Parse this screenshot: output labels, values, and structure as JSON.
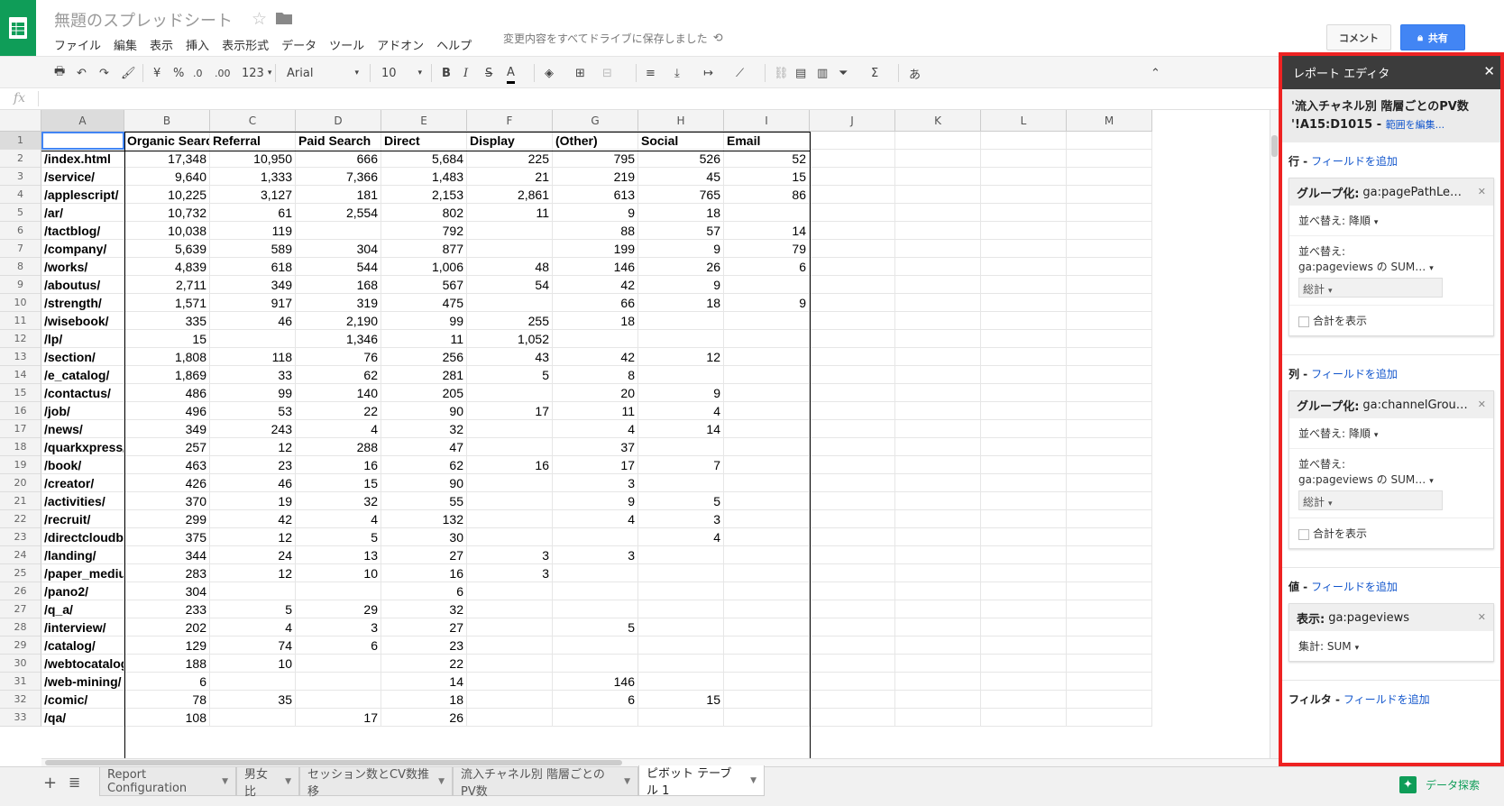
{
  "doc": {
    "title": "無題のスプレッドシート",
    "saved_status": "変更内容をすべてドライブに保存しました",
    "comment_label": "コメント",
    "share_label": "共有"
  },
  "menu": [
    "ファイル",
    "編集",
    "表示",
    "挿入",
    "表示形式",
    "データ",
    "ツール",
    "アドオン",
    "ヘルプ"
  ],
  "toolbar": {
    "currency": "¥",
    "percent": "%",
    "dec_less": ".0",
    "dec_more": ".00",
    "format_more": "123",
    "font": "Arial",
    "size": "10",
    "bold": "B",
    "italic": "I",
    "strike": "S",
    "text_color": "A",
    "sum": "Σ",
    "input": "あ"
  },
  "formula_bar": {
    "fx": "fx",
    "value": ""
  },
  "columns": [
    "A",
    "B",
    "C",
    "D",
    "E",
    "F",
    "G",
    "H",
    "I",
    "J",
    "K",
    "L",
    "M"
  ],
  "header_row": [
    "",
    "Organic Search",
    "Referral",
    "Paid Search",
    "Direct",
    "Display",
    "(Other)",
    "Social",
    "Email"
  ],
  "rows": [
    [
      "/index.html",
      "17,348",
      "10,950",
      "666",
      "5,684",
      "225",
      "795",
      "526",
      "52"
    ],
    [
      "/service/",
      "9,640",
      "1,333",
      "7,366",
      "1,483",
      "21",
      "219",
      "45",
      "15"
    ],
    [
      "/applescript/",
      "10,225",
      "3,127",
      "181",
      "2,153",
      "2,861",
      "613",
      "765",
      "86"
    ],
    [
      "/ar/",
      "10,732",
      "61",
      "2,554",
      "802",
      "11",
      "9",
      "18",
      ""
    ],
    [
      "/tactblog/",
      "10,038",
      "119",
      "",
      "792",
      "",
      "88",
      "57",
      "14"
    ],
    [
      "/company/",
      "5,639",
      "589",
      "304",
      "877",
      "",
      "199",
      "9",
      "79"
    ],
    [
      "/works/",
      "4,839",
      "618",
      "544",
      "1,006",
      "48",
      "146",
      "26",
      "6"
    ],
    [
      "/aboutus/",
      "2,711",
      "349",
      "168",
      "567",
      "54",
      "42",
      "9",
      ""
    ],
    [
      "/strength/",
      "1,571",
      "917",
      "319",
      "475",
      "",
      "66",
      "18",
      "9"
    ],
    [
      "/wisebook/",
      "335",
      "46",
      "2,190",
      "99",
      "255",
      "18",
      "",
      ""
    ],
    [
      "/lp/",
      "15",
      "",
      "1,346",
      "11",
      "1,052",
      "",
      "",
      ""
    ],
    [
      "/section/",
      "1,808",
      "118",
      "76",
      "256",
      "43",
      "42",
      "12",
      ""
    ],
    [
      "/e_catalog/",
      "1,869",
      "33",
      "62",
      "281",
      "5",
      "8",
      "",
      ""
    ],
    [
      "/contactus/",
      "486",
      "99",
      "140",
      "205",
      "",
      "20",
      "9",
      ""
    ],
    [
      "/job/",
      "496",
      "53",
      "22",
      "90",
      "17",
      "11",
      "4",
      ""
    ],
    [
      "/news/",
      "349",
      "243",
      "4",
      "32",
      "",
      "4",
      "14",
      ""
    ],
    [
      "/quarkxpress/",
      "257",
      "12",
      "288",
      "47",
      "",
      "37",
      "",
      ""
    ],
    [
      "/book/",
      "463",
      "23",
      "16",
      "62",
      "16",
      "17",
      "7",
      ""
    ],
    [
      "/creator/",
      "426",
      "46",
      "15",
      "90",
      "",
      "3",
      "",
      ""
    ],
    [
      "/activities/",
      "370",
      "19",
      "32",
      "55",
      "",
      "9",
      "5",
      ""
    ],
    [
      "/recruit/",
      "299",
      "42",
      "4",
      "132",
      "",
      "4",
      "3",
      ""
    ],
    [
      "/directcloudbox/",
      "375",
      "12",
      "5",
      "30",
      "",
      "",
      "4",
      ""
    ],
    [
      "/landing/",
      "344",
      "24",
      "13",
      "27",
      "3",
      "3",
      "",
      ""
    ],
    [
      "/paper_medium/",
      "283",
      "12",
      "10",
      "16",
      "3",
      "",
      "",
      ""
    ],
    [
      "/pano2/",
      "304",
      "",
      "",
      "6",
      "",
      "",
      "",
      ""
    ],
    [
      "/q_a/",
      "233",
      "5",
      "29",
      "32",
      "",
      "",
      "",
      ""
    ],
    [
      "/interview/",
      "202",
      "4",
      "3",
      "27",
      "",
      "5",
      "",
      ""
    ],
    [
      "/catalog/",
      "129",
      "74",
      "6",
      "23",
      "",
      "",
      "",
      ""
    ],
    [
      "/webtocatalog/",
      "188",
      "10",
      "",
      "22",
      "",
      "",
      "",
      ""
    ],
    [
      "/web-mining/",
      "6",
      "",
      "",
      "14",
      "",
      "146",
      "",
      ""
    ],
    [
      "/comic/",
      "78",
      "35",
      "",
      "18",
      "",
      "6",
      "15",
      ""
    ],
    [
      "/qa/",
      "108",
      "",
      "17",
      "26",
      "",
      "",
      "",
      ""
    ]
  ],
  "sheet_tabs": [
    {
      "label": "Report Configuration",
      "active": false
    },
    {
      "label": "男女比",
      "active": false
    },
    {
      "label": "セッション数とCV数推移",
      "active": false
    },
    {
      "label": "流入チャネル別 階層ごとのPV数",
      "active": false
    },
    {
      "label": "ピボット テーブル 1",
      "active": true
    }
  ],
  "explore_label": "データ探索",
  "panel": {
    "title": "レポート エディタ",
    "range_line1": "'流入チャネル別 階層ごとのPV数",
    "range_line2": "'!A15:D1015 -",
    "range_edit": "範囲を編集...",
    "add_field": "フィールドを追加",
    "rows_label": "行 -",
    "cols_label": "列 -",
    "values_label": "値 -",
    "filter_label": "フィルタ -",
    "row_group": {
      "prefix": "グループ化:",
      "field": "ga:pagePathLe…",
      "sort": "並べ替え: 降順",
      "sortby_label": "並べ替え:",
      "sortby_value": "ga:pageviews の SUM…",
      "total": "総計",
      "show_total": "合計を表示"
    },
    "col_group": {
      "prefix": "グループ化:",
      "field": "ga:channelGrou…",
      "sort": "並べ替え: 降順",
      "sortby_label": "並べ替え:",
      "sortby_value": "ga:pageviews の SUM…",
      "total": "総計",
      "show_total": "合計を表示"
    },
    "value": {
      "prefix": "表示:",
      "field": "ga:pageviews",
      "agg": "集計: SUM"
    }
  },
  "colors": {
    "brand_green": "#0f9d58",
    "share_blue": "#4285f4",
    "highlight_red": "#e22",
    "link_blue": "#15c"
  }
}
